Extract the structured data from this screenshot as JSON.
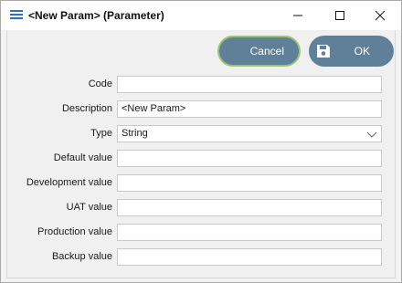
{
  "window": {
    "title": "<New Param> (Parameter)",
    "icon": "menu-lines-icon"
  },
  "toolbar": {
    "cancel_label": "Cancel",
    "ok_label": "OK",
    "ok_icon": "save-icon"
  },
  "form": {
    "fields": [
      {
        "label": "Code",
        "value": ""
      },
      {
        "label": "Description",
        "value": "<New Param>"
      },
      {
        "label": "Type",
        "value": "String"
      },
      {
        "label": "Default value",
        "value": ""
      },
      {
        "label": "Development value",
        "value": ""
      },
      {
        "label": "UAT value",
        "value": ""
      },
      {
        "label": "Production value",
        "value": ""
      },
      {
        "label": "Backup value",
        "value": ""
      }
    ]
  },
  "colors": {
    "button_bg": "#607f98",
    "cancel_focus_border": "#9bc46f",
    "title_icon": "#2c6fbf"
  }
}
